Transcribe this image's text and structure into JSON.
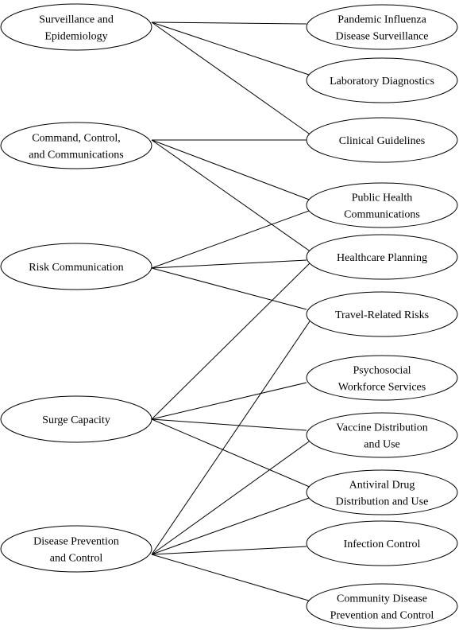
{
  "left_nodes": [
    {
      "id": "surveillance",
      "lines": [
        "Surveillance and",
        "Epidemiology"
      ]
    },
    {
      "id": "command",
      "lines": [
        "Command, Control,",
        "and Communications"
      ]
    },
    {
      "id": "risk",
      "lines": [
        "Risk Communication"
      ]
    },
    {
      "id": "surge",
      "lines": [
        "Surge Capacity"
      ]
    },
    {
      "id": "prevention",
      "lines": [
        "Disease Prevention",
        "and Control"
      ]
    }
  ],
  "right_nodes": [
    {
      "id": "pandemic",
      "lines": [
        "Pandemic Influenza",
        "Disease Surveillance"
      ]
    },
    {
      "id": "lab",
      "lines": [
        "Laboratory Diagnostics"
      ]
    },
    {
      "id": "clinical",
      "lines": [
        "Clinical Guidelines"
      ]
    },
    {
      "id": "publichealth",
      "lines": [
        "Public Health",
        "Communications"
      ]
    },
    {
      "id": "healthcare",
      "lines": [
        "Healthcare Planning"
      ]
    },
    {
      "id": "travel",
      "lines": [
        "Travel-Related Risks"
      ]
    },
    {
      "id": "psychosocial",
      "lines": [
        "Psychosocial",
        "Workforce Services"
      ]
    },
    {
      "id": "vaccine",
      "lines": [
        "Vaccine Distribution",
        "and Use"
      ]
    },
    {
      "id": "antiviral",
      "lines": [
        "Antiviral Drug",
        "Distribution and Use"
      ]
    },
    {
      "id": "infection",
      "lines": [
        "Infection Control"
      ]
    },
    {
      "id": "community",
      "lines": [
        "Community Disease",
        "Prevention and Control"
      ]
    }
  ],
  "edges": [
    [
      "surveillance",
      "pandemic"
    ],
    [
      "surveillance",
      "lab"
    ],
    [
      "surveillance",
      "clinical"
    ],
    [
      "command",
      "clinical"
    ],
    [
      "command",
      "publichealth"
    ],
    [
      "command",
      "healthcare"
    ],
    [
      "risk",
      "publichealth"
    ],
    [
      "risk",
      "healthcare"
    ],
    [
      "risk",
      "travel"
    ],
    [
      "surge",
      "healthcare"
    ],
    [
      "surge",
      "psychosocial"
    ],
    [
      "surge",
      "vaccine"
    ],
    [
      "surge",
      "antiviral"
    ],
    [
      "prevention",
      "travel"
    ],
    [
      "prevention",
      "vaccine"
    ],
    [
      "prevention",
      "antiviral"
    ],
    [
      "prevention",
      "infection"
    ],
    [
      "prevention",
      "community"
    ]
  ]
}
